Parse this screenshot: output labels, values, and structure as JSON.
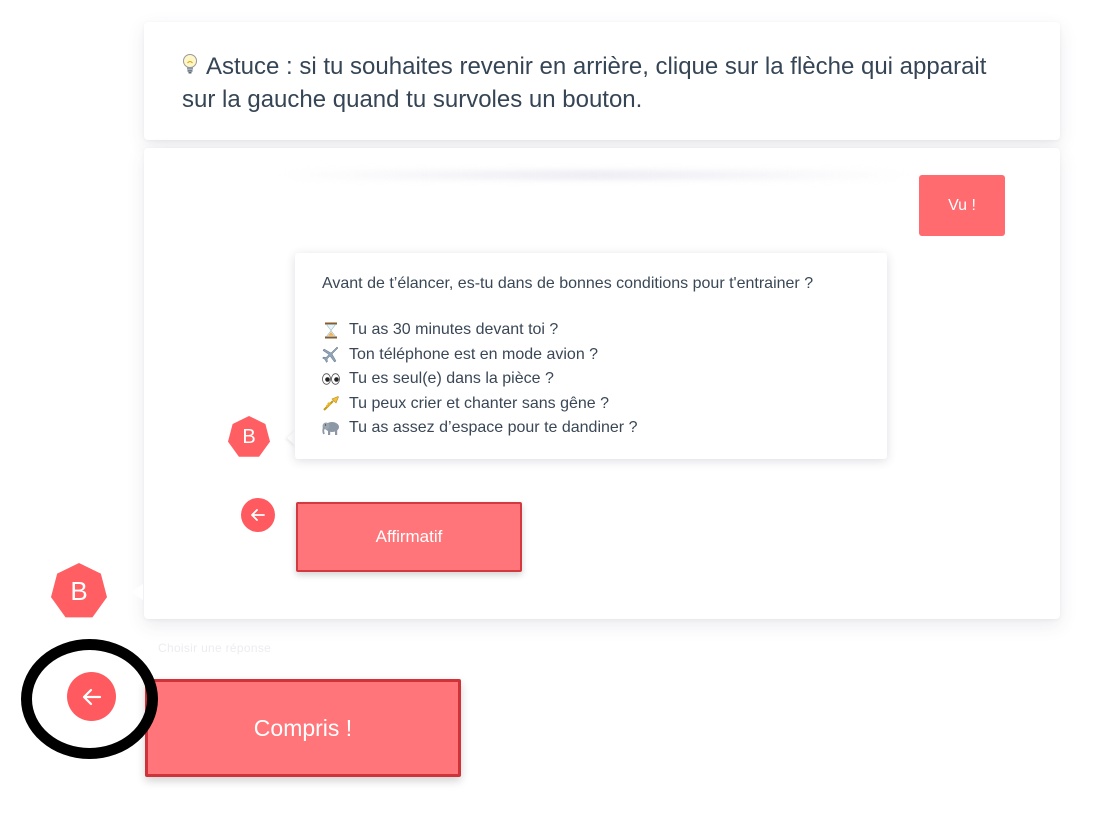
{
  "tip": {
    "icon": "lightbulb-icon",
    "text": "Astuce : si tu souhaites revenir en arrière, clique sur la flèche qui apparait sur la gauche quand tu survoles un bouton."
  },
  "chat": {
    "previous_answer": "Vu !",
    "bot_initial": "B",
    "message_intro": "Avant de t’élancer, es-tu dans de bonnes conditions pour t'entrainer ?",
    "checklist": [
      {
        "icon": "hourglass-icon",
        "text": "Tu as 30 minutes devant toi ?"
      },
      {
        "icon": "airplane-icon",
        "text": "Ton téléphone est en mode avion ?"
      },
      {
        "icon": "eyes-icon",
        "text": "Tu es seul(e) dans la pièce ?"
      },
      {
        "icon": "trumpet-icon",
        "text": "Tu peux crier et chanter sans gêne ?"
      },
      {
        "icon": "elephant-icon",
        "text": "Tu as assez d’espace pour te dandiner ?"
      }
    ],
    "answer_button": "Affirmatif"
  },
  "footer": {
    "bot_initial": "B",
    "faint_label": "Choisir une réponse",
    "confirm_button": "Compris !"
  },
  "colors": {
    "accent": "#ff6b6f",
    "button_border": "#d23a40",
    "text": "#354555",
    "annotation": "#000000"
  }
}
